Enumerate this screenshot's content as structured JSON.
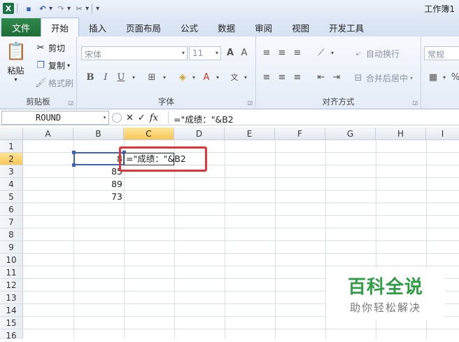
{
  "window": {
    "title": "工作簿1"
  },
  "tabs": {
    "file": "文件",
    "items": [
      "开始",
      "插入",
      "页面布局",
      "公式",
      "数据",
      "审阅",
      "视图",
      "开发工具"
    ]
  },
  "clipboard": {
    "paste": "粘贴",
    "cut": "剪切",
    "copy": "复制",
    "format_painter": "格式刷",
    "label": "剪贴板"
  },
  "font": {
    "name_placeholder": "宋体",
    "size": "11",
    "label": "字体",
    "bold": "B",
    "italic": "I",
    "underline": "U"
  },
  "alignment": {
    "wrap": "自动换行",
    "merge": "合并后居中",
    "label": "对齐方式"
  },
  "number": {
    "format": "常规"
  },
  "formula_bar": {
    "name_box": "ROUND",
    "content": "=\"成绩：\"&B2"
  },
  "columns": [
    "A",
    "B",
    "C",
    "D",
    "E",
    "F",
    "G",
    "H",
    "I"
  ],
  "rows": [
    "1",
    "2",
    "3",
    "4",
    "5",
    "6",
    "7",
    "8",
    "9",
    "10",
    "11",
    "12",
    "13",
    "14",
    "15",
    "16"
  ],
  "cells": {
    "b2": "8",
    "b3": "85",
    "b4": "89",
    "b5": "73",
    "c2_edit": "=\"成绩：\"&B2"
  },
  "watermark": {
    "main": "百科全说",
    "sub": "助你轻松解决"
  }
}
